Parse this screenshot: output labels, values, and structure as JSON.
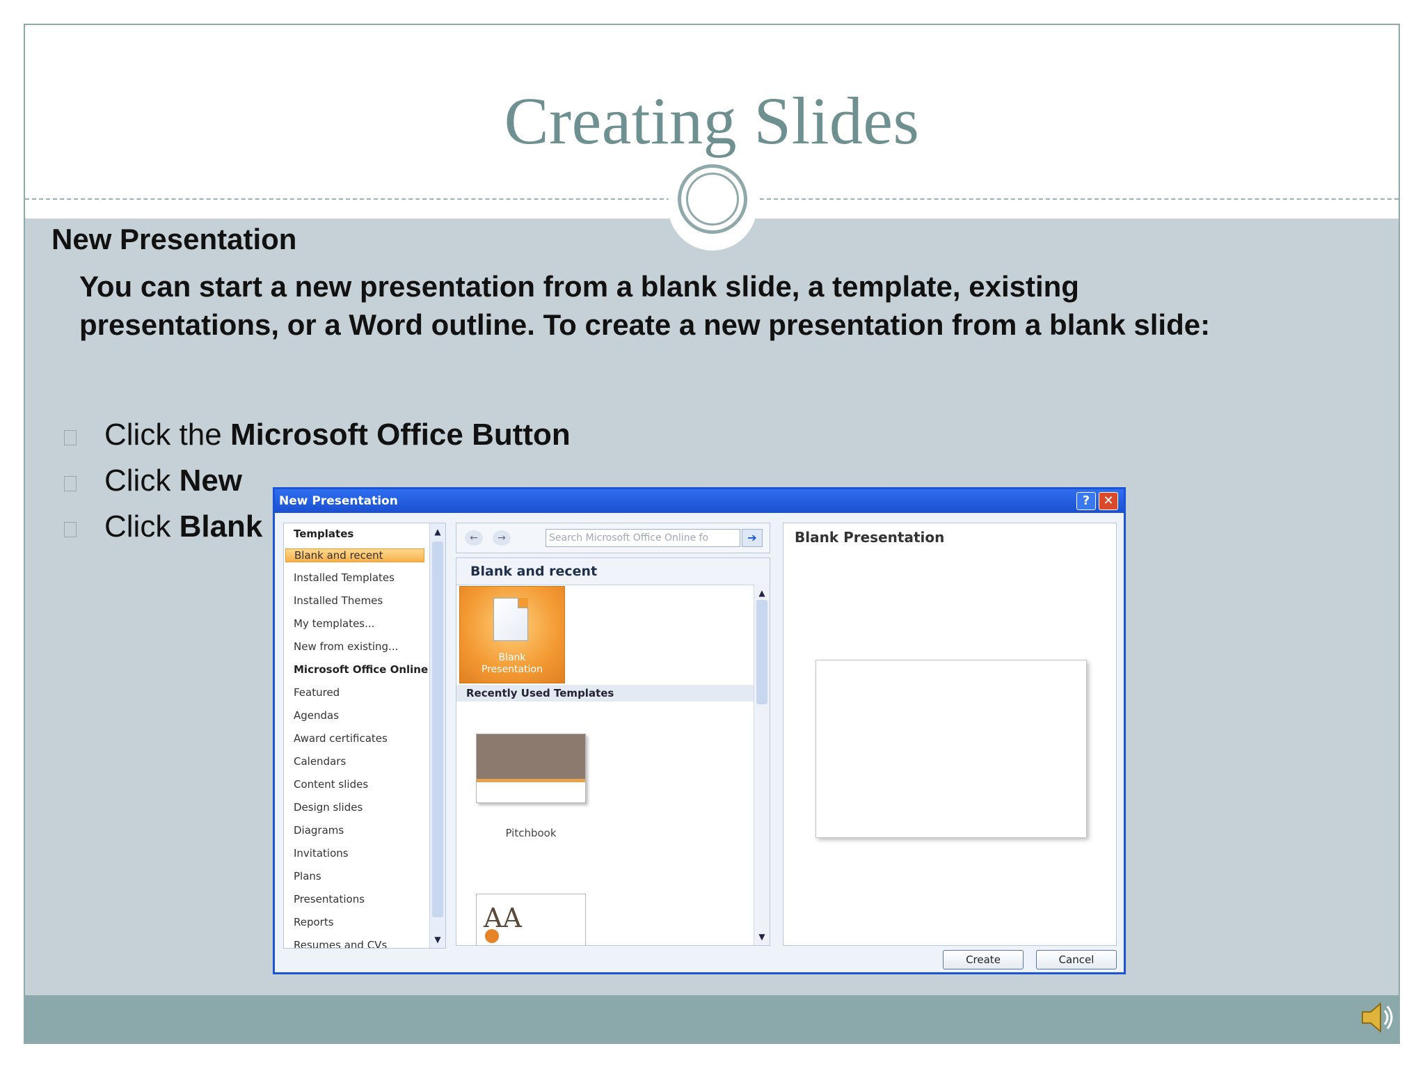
{
  "slide": {
    "title": "Creating Slides",
    "heading": "New Presentation",
    "paragraph": "You can start a new presentation from a blank slide, a template,  existing presentations, or a Word outline. To create a new presentation from a blank slide:",
    "bullets": [
      {
        "prefix": "Click the ",
        "bold": "Microsoft Office Button"
      },
      {
        "prefix": "Click ",
        "bold": "New"
      },
      {
        "prefix": "Click ",
        "bold": "Blank P"
      }
    ]
  },
  "dialog": {
    "title": "New Presentation",
    "help_button": "?",
    "close_button": "✕",
    "templates_header": "Templates",
    "left_items": [
      {
        "label": "Blank and recent",
        "kind": "selected"
      },
      {
        "label": "Installed Templates",
        "kind": "item"
      },
      {
        "label": "Installed Themes",
        "kind": "item"
      },
      {
        "label": "My templates...",
        "kind": "item"
      },
      {
        "label": "New from existing...",
        "kind": "item"
      },
      {
        "label": "Microsoft Office Online",
        "kind": "header"
      },
      {
        "label": "Featured",
        "kind": "item"
      },
      {
        "label": "Agendas",
        "kind": "item"
      },
      {
        "label": "Award certificates",
        "kind": "item"
      },
      {
        "label": "Calendars",
        "kind": "item"
      },
      {
        "label": "Content slides",
        "kind": "item"
      },
      {
        "label": "Design slides",
        "kind": "item"
      },
      {
        "label": "Diagrams",
        "kind": "item"
      },
      {
        "label": "Invitations",
        "kind": "item"
      },
      {
        "label": "Plans",
        "kind": "item"
      },
      {
        "label": "Presentations",
        "kind": "item"
      },
      {
        "label": "Reports",
        "kind": "item"
      },
      {
        "label": "Resumes and CVs",
        "kind": "item"
      }
    ],
    "search_placeholder": "Search Microsoft Office Online fo",
    "middle_header": "Blank and recent",
    "blank_tile_label_1": "Blank",
    "blank_tile_label_2": "Presentation",
    "recent_header": "Recently Used Templates",
    "pitchbook_label": "Pitchbook",
    "aa_thumb_text": "AA",
    "preview_title": "Blank Presentation",
    "create_button": "Create",
    "cancel_button": "Cancel"
  },
  "icons": {
    "back": "back-arrow-icon",
    "forward": "forward-arrow-icon",
    "search_go": "arrow-right-icon",
    "speaker": "speaker-icon",
    "blank_doc": "blank-document-icon"
  },
  "colors": {
    "title": "#6f9090",
    "panel": "#c5d1d6",
    "footer": "#8ba9ab",
    "dialog_title": "#1b55d6",
    "selection": "#f6b04c"
  }
}
